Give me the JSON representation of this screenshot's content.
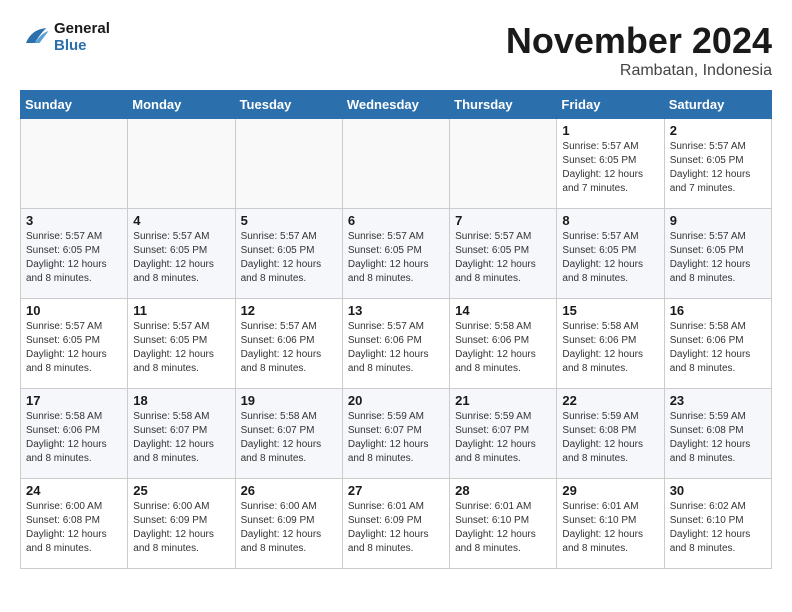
{
  "header": {
    "logo_line1": "General",
    "logo_line2": "Blue",
    "month": "November 2024",
    "location": "Rambatan, Indonesia"
  },
  "days_of_week": [
    "Sunday",
    "Monday",
    "Tuesday",
    "Wednesday",
    "Thursday",
    "Friday",
    "Saturday"
  ],
  "weeks": [
    [
      {
        "day": "",
        "info": ""
      },
      {
        "day": "",
        "info": ""
      },
      {
        "day": "",
        "info": ""
      },
      {
        "day": "",
        "info": ""
      },
      {
        "day": "",
        "info": ""
      },
      {
        "day": "1",
        "info": "Sunrise: 5:57 AM\nSunset: 6:05 PM\nDaylight: 12 hours and 7 minutes."
      },
      {
        "day": "2",
        "info": "Sunrise: 5:57 AM\nSunset: 6:05 PM\nDaylight: 12 hours and 7 minutes."
      }
    ],
    [
      {
        "day": "3",
        "info": "Sunrise: 5:57 AM\nSunset: 6:05 PM\nDaylight: 12 hours and 8 minutes."
      },
      {
        "day": "4",
        "info": "Sunrise: 5:57 AM\nSunset: 6:05 PM\nDaylight: 12 hours and 8 minutes."
      },
      {
        "day": "5",
        "info": "Sunrise: 5:57 AM\nSunset: 6:05 PM\nDaylight: 12 hours and 8 minutes."
      },
      {
        "day": "6",
        "info": "Sunrise: 5:57 AM\nSunset: 6:05 PM\nDaylight: 12 hours and 8 minutes."
      },
      {
        "day": "7",
        "info": "Sunrise: 5:57 AM\nSunset: 6:05 PM\nDaylight: 12 hours and 8 minutes."
      },
      {
        "day": "8",
        "info": "Sunrise: 5:57 AM\nSunset: 6:05 PM\nDaylight: 12 hours and 8 minutes."
      },
      {
        "day": "9",
        "info": "Sunrise: 5:57 AM\nSunset: 6:05 PM\nDaylight: 12 hours and 8 minutes."
      }
    ],
    [
      {
        "day": "10",
        "info": "Sunrise: 5:57 AM\nSunset: 6:05 PM\nDaylight: 12 hours and 8 minutes."
      },
      {
        "day": "11",
        "info": "Sunrise: 5:57 AM\nSunset: 6:05 PM\nDaylight: 12 hours and 8 minutes."
      },
      {
        "day": "12",
        "info": "Sunrise: 5:57 AM\nSunset: 6:06 PM\nDaylight: 12 hours and 8 minutes."
      },
      {
        "day": "13",
        "info": "Sunrise: 5:57 AM\nSunset: 6:06 PM\nDaylight: 12 hours and 8 minutes."
      },
      {
        "day": "14",
        "info": "Sunrise: 5:58 AM\nSunset: 6:06 PM\nDaylight: 12 hours and 8 minutes."
      },
      {
        "day": "15",
        "info": "Sunrise: 5:58 AM\nSunset: 6:06 PM\nDaylight: 12 hours and 8 minutes."
      },
      {
        "day": "16",
        "info": "Sunrise: 5:58 AM\nSunset: 6:06 PM\nDaylight: 12 hours and 8 minutes."
      }
    ],
    [
      {
        "day": "17",
        "info": "Sunrise: 5:58 AM\nSunset: 6:06 PM\nDaylight: 12 hours and 8 minutes."
      },
      {
        "day": "18",
        "info": "Sunrise: 5:58 AM\nSunset: 6:07 PM\nDaylight: 12 hours and 8 minutes."
      },
      {
        "day": "19",
        "info": "Sunrise: 5:58 AM\nSunset: 6:07 PM\nDaylight: 12 hours and 8 minutes."
      },
      {
        "day": "20",
        "info": "Sunrise: 5:59 AM\nSunset: 6:07 PM\nDaylight: 12 hours and 8 minutes."
      },
      {
        "day": "21",
        "info": "Sunrise: 5:59 AM\nSunset: 6:07 PM\nDaylight: 12 hours and 8 minutes."
      },
      {
        "day": "22",
        "info": "Sunrise: 5:59 AM\nSunset: 6:08 PM\nDaylight: 12 hours and 8 minutes."
      },
      {
        "day": "23",
        "info": "Sunrise: 5:59 AM\nSunset: 6:08 PM\nDaylight: 12 hours and 8 minutes."
      }
    ],
    [
      {
        "day": "24",
        "info": "Sunrise: 6:00 AM\nSunset: 6:08 PM\nDaylight: 12 hours and 8 minutes."
      },
      {
        "day": "25",
        "info": "Sunrise: 6:00 AM\nSunset: 6:09 PM\nDaylight: 12 hours and 8 minutes."
      },
      {
        "day": "26",
        "info": "Sunrise: 6:00 AM\nSunset: 6:09 PM\nDaylight: 12 hours and 8 minutes."
      },
      {
        "day": "27",
        "info": "Sunrise: 6:01 AM\nSunset: 6:09 PM\nDaylight: 12 hours and 8 minutes."
      },
      {
        "day": "28",
        "info": "Sunrise: 6:01 AM\nSunset: 6:10 PM\nDaylight: 12 hours and 8 minutes."
      },
      {
        "day": "29",
        "info": "Sunrise: 6:01 AM\nSunset: 6:10 PM\nDaylight: 12 hours and 8 minutes."
      },
      {
        "day": "30",
        "info": "Sunrise: 6:02 AM\nSunset: 6:10 PM\nDaylight: 12 hours and 8 minutes."
      }
    ]
  ]
}
